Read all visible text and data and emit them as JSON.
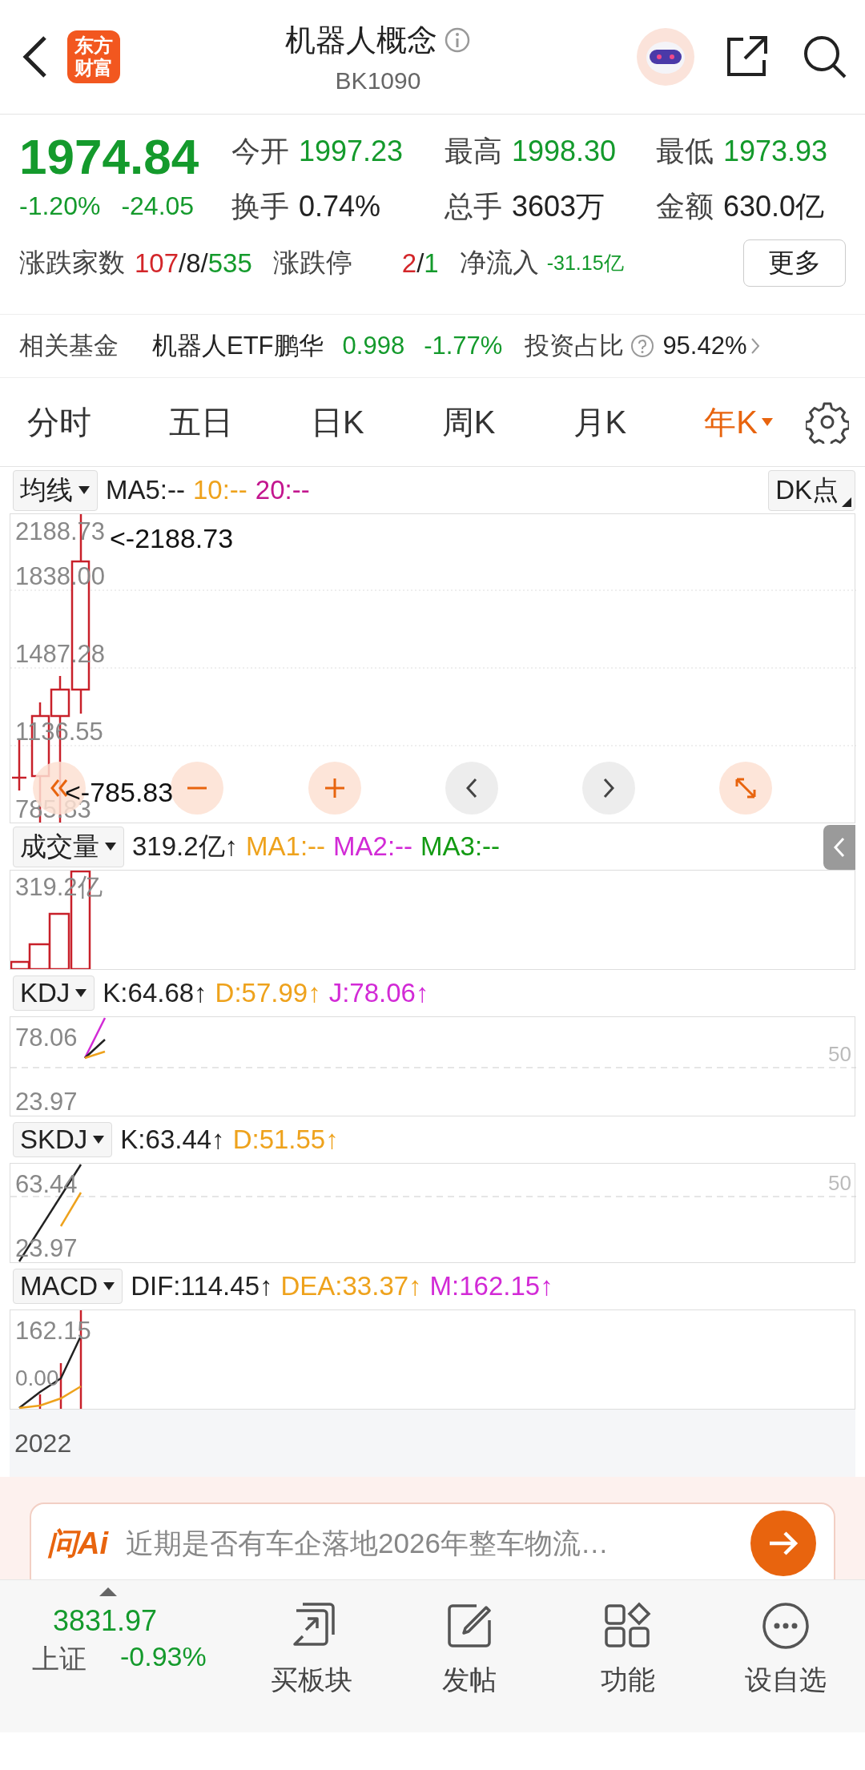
{
  "header": {
    "logo_text": "东方财富",
    "title": "机器人概念",
    "code": "BK1090"
  },
  "quote": {
    "price": "1974.84",
    "change_pct": "-1.20%",
    "change": "-24.05",
    "stats": [
      {
        "label": "今开",
        "value": "1997.23",
        "color": "#149a2c"
      },
      {
        "label": "最高",
        "value": "1998.30",
        "color": "#149a2c"
      },
      {
        "label": "最低",
        "value": "1973.93",
        "color": "#149a2c"
      },
      {
        "label": "换手",
        "value": "0.74%",
        "color": "#222222"
      },
      {
        "label": "总手",
        "value": "3603万",
        "color": "#222222"
      },
      {
        "label": "金额",
        "value": "630.0亿",
        "color": "#222222"
      }
    ],
    "breadth": {
      "label": "涨跌家数",
      "up": "107",
      "flat": "8",
      "down": "535",
      "separator": "/"
    },
    "limit": {
      "label": "涨跌停",
      "up": "2",
      "down": "1",
      "separator": "/"
    },
    "net_inflow": {
      "label": "净流入",
      "value": "-31.15亿"
    },
    "more_button": "更多"
  },
  "fund": {
    "label": "相关基金",
    "name": "机器人ETF鹏华",
    "price": "0.998",
    "change": "-1.77%",
    "ratio_label": "投资占比",
    "ratio": "95.42%"
  },
  "period_tabs": [
    {
      "label": "分时",
      "selected": false
    },
    {
      "label": "五日",
      "selected": false
    },
    {
      "label": "日K",
      "selected": false
    },
    {
      "label": "周K",
      "selected": false
    },
    {
      "label": "月K",
      "selected": false
    },
    {
      "label": "年K",
      "selected": true
    }
  ],
  "main_chart": {
    "indicator": "均线",
    "legend": [
      {
        "text": "MA5:--",
        "color": "#222222"
      },
      {
        "text": "10:--",
        "color": "#eea21c"
      },
      {
        "text": "20:--",
        "color": "#c3168e"
      }
    ],
    "dk_button": "DK点",
    "y_labels": [
      "2188.73",
      "1838.00",
      "1487.28",
      "1136.55",
      "785.83"
    ],
    "max_marker": "<-2188.73",
    "min_marker": "<-785.83"
  },
  "panels": [
    {
      "kind": "volume",
      "indicator": "成交量",
      "legend": [
        {
          "text": "319.2亿↑",
          "color": "#222222"
        },
        {
          "text": "MA1:--",
          "color": "#eea21c"
        },
        {
          "text": "MA2:--",
          "color": "#d22ad6"
        },
        {
          "text": "MA3:--",
          "color": "#129a12"
        }
      ],
      "top_label": "319.2亿"
    },
    {
      "kind": "kdj",
      "indicator": "KDJ",
      "legend": [
        {
          "text": "K:64.68↑",
          "color": "#222222"
        },
        {
          "text": "D:57.99↑",
          "color": "#eea21c"
        },
        {
          "text": "J:78.06↑",
          "color": "#d22ad6"
        }
      ],
      "top_label": "78.06",
      "bottom_label": "23.97",
      "mid_label": "50"
    },
    {
      "kind": "skdj",
      "indicator": "SKDJ",
      "legend": [
        {
          "text": "K:63.44↑",
          "color": "#222222"
        },
        {
          "text": "D:51.55↑",
          "color": "#eea21c"
        }
      ],
      "top_label": "63.44",
      "bottom_label": "23.97",
      "mid_label": "50"
    },
    {
      "kind": "macd",
      "indicator": "MACD",
      "legend": [
        {
          "text": "DIF:114.45↑",
          "color": "#222222"
        },
        {
          "text": "DEA:33.37↑",
          "color": "#eea21c"
        },
        {
          "text": "M:162.15↑",
          "color": "#d22ad6"
        }
      ],
      "top_label": "162.15",
      "bottom_label": "0.00"
    }
  ],
  "date_label": "2022",
  "ai": {
    "badge": "问Ai",
    "prompt": "近期是否有车企落地2026年整车物流…"
  },
  "bottom_nav": {
    "index": {
      "value": "3831.97",
      "name": "上证",
      "change": "-0.93%"
    },
    "items": [
      {
        "label": "买板块",
        "kind": "board"
      },
      {
        "label": "发帖",
        "kind": "post"
      },
      {
        "label": "功能",
        "kind": "apps"
      },
      {
        "label": "设自选",
        "kind": "more"
      }
    ]
  }
}
